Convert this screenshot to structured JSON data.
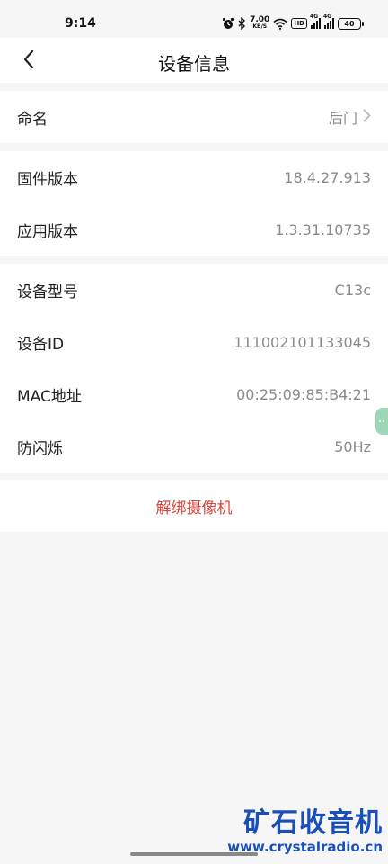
{
  "status_bar": {
    "time": "9:14",
    "net_speed_value": "7.00",
    "net_speed_unit": "KB/S",
    "hd": "HD",
    "sim1": "4G",
    "sim2": "4G",
    "battery": "40"
  },
  "header": {
    "title": "设备信息"
  },
  "name_section": {
    "label": "命名",
    "value": "后门"
  },
  "version_section": {
    "rows": [
      {
        "label": "固件版本",
        "value": "18.4.27.913"
      },
      {
        "label": "应用版本",
        "value": "1.3.31.10735"
      }
    ]
  },
  "device_section": {
    "rows": [
      {
        "label": "设备型号",
        "value": "C13c"
      },
      {
        "label": "设备ID",
        "value": "111002101133045"
      },
      {
        "label": "MAC地址",
        "value": "00:25:09:85:B4:21"
      },
      {
        "label": "防闪烁",
        "value": "50Hz"
      }
    ]
  },
  "unbind_label": "解绑摄像机",
  "watermark": {
    "title": "矿石收音机",
    "url": "www.crystalradio.cn"
  },
  "colors": {
    "accent_red": "#d9463c",
    "watermark_blue": "#1a4fb8"
  }
}
